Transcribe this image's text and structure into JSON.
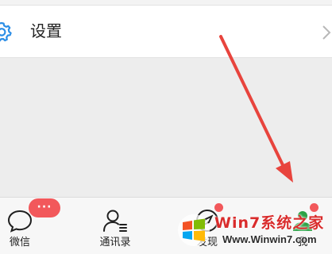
{
  "settings": {
    "label": "设置",
    "icon": "gear-icon",
    "accent_color": "#2c8ee6"
  },
  "tabs": [
    {
      "label": "微信",
      "icon": "chat-bubble-icon",
      "badge": "···"
    },
    {
      "label": "通讯录",
      "icon": "contacts-icon"
    },
    {
      "label": "发现",
      "icon": "compass-icon",
      "dot": true
    },
    {
      "label": "我",
      "icon": "person-icon",
      "dot": true
    }
  ],
  "colors": {
    "badge": "#f2585b",
    "annotation_arrow": "#e8443d",
    "active_tab": "#2ba245"
  },
  "watermark": {
    "title": "Win7系统之家",
    "url": "Www.Winwin7.com"
  }
}
